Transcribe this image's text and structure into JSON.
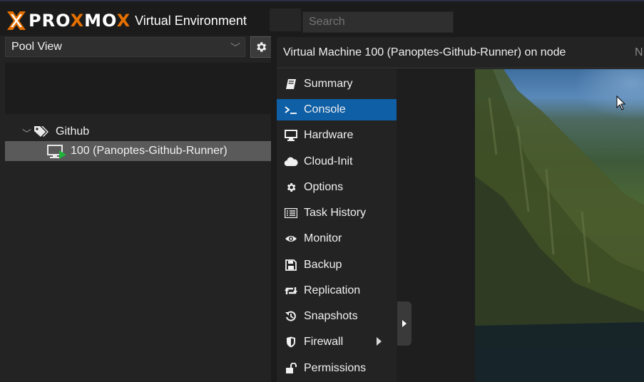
{
  "header": {
    "logo_text": "PROXMOX",
    "product_name": "Virtual Environment",
    "search_placeholder": "Search"
  },
  "sidebar": {
    "view_select": "Pool View",
    "tree": [
      {
        "type": "pool",
        "label": "Github",
        "expanded": true
      },
      {
        "type": "vm",
        "label": "100 (Panoptes-Github-Runner)",
        "status": "running",
        "selected": true
      }
    ]
  },
  "content": {
    "title": "Virtual Machine 100 (Panoptes-Github-Runner) on node",
    "title_overflow": "N",
    "nav": [
      {
        "label": "Summary",
        "icon": "book-icon"
      },
      {
        "label": "Console",
        "icon": "terminal-icon",
        "active": true
      },
      {
        "label": "Hardware",
        "icon": "desktop-icon"
      },
      {
        "label": "Cloud-Init",
        "icon": "cloud-icon"
      },
      {
        "label": "Options",
        "icon": "gear-icon"
      },
      {
        "label": "Task History",
        "icon": "list-icon"
      },
      {
        "label": "Monitor",
        "icon": "eye-icon"
      },
      {
        "label": "Backup",
        "icon": "floppy-icon"
      },
      {
        "label": "Replication",
        "icon": "retweet-icon"
      },
      {
        "label": "Snapshots",
        "icon": "history-icon"
      },
      {
        "label": "Firewall",
        "icon": "shield-icon",
        "has_submenu": true
      },
      {
        "label": "Permissions",
        "icon": "unlock-icon"
      }
    ]
  },
  "colors": {
    "accent_orange": "#e57000",
    "active_blue": "#0e5fa6",
    "running_green": "#1fb33c"
  }
}
